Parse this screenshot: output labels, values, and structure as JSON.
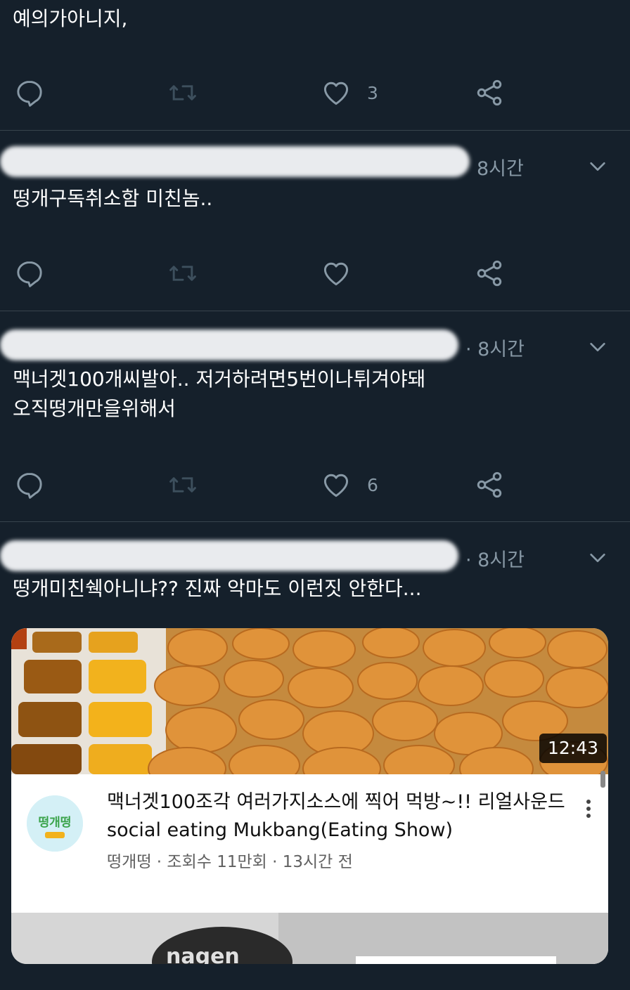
{
  "tweets": [
    {
      "text": "예의가아니지,",
      "reply_count": "",
      "like_count": "3"
    },
    {
      "time": "8시간",
      "text": "떵개구독취소함 미친놈..",
      "like_count": ""
    },
    {
      "time": "· 8시간",
      "text_line1": "맥너겟100개씨발아.. 저거하려면5번이나튀겨야돼",
      "text_line2": "오직떵개만을위해서",
      "like_count": "6"
    },
    {
      "time": "· 8시간",
      "text": "떵개미친쉑아니냐?? 진짜 악마도 이런짓 안한다..."
    }
  ],
  "video": {
    "duration": "12:43",
    "title": "맥너겟100조각 여러가지소스에 찍어 먹방~!! 리얼사운드 social eating Mukbang(Eating Show)",
    "channel": "떵개떵",
    "meta": "떵개떵 · 조회수 11만회 · 13시간 전",
    "channel_logo_text": "떵개떵",
    "second_thumb_text": "nagen"
  },
  "icons": [
    "reply-icon",
    "retweet-icon",
    "like-icon",
    "share-icon",
    "chevron-down-icon",
    "more-options-icon"
  ],
  "colors": {
    "background": "#15202b",
    "divider": "#38444d",
    "muted_text": "#8899a6",
    "text": "#ffffff"
  }
}
